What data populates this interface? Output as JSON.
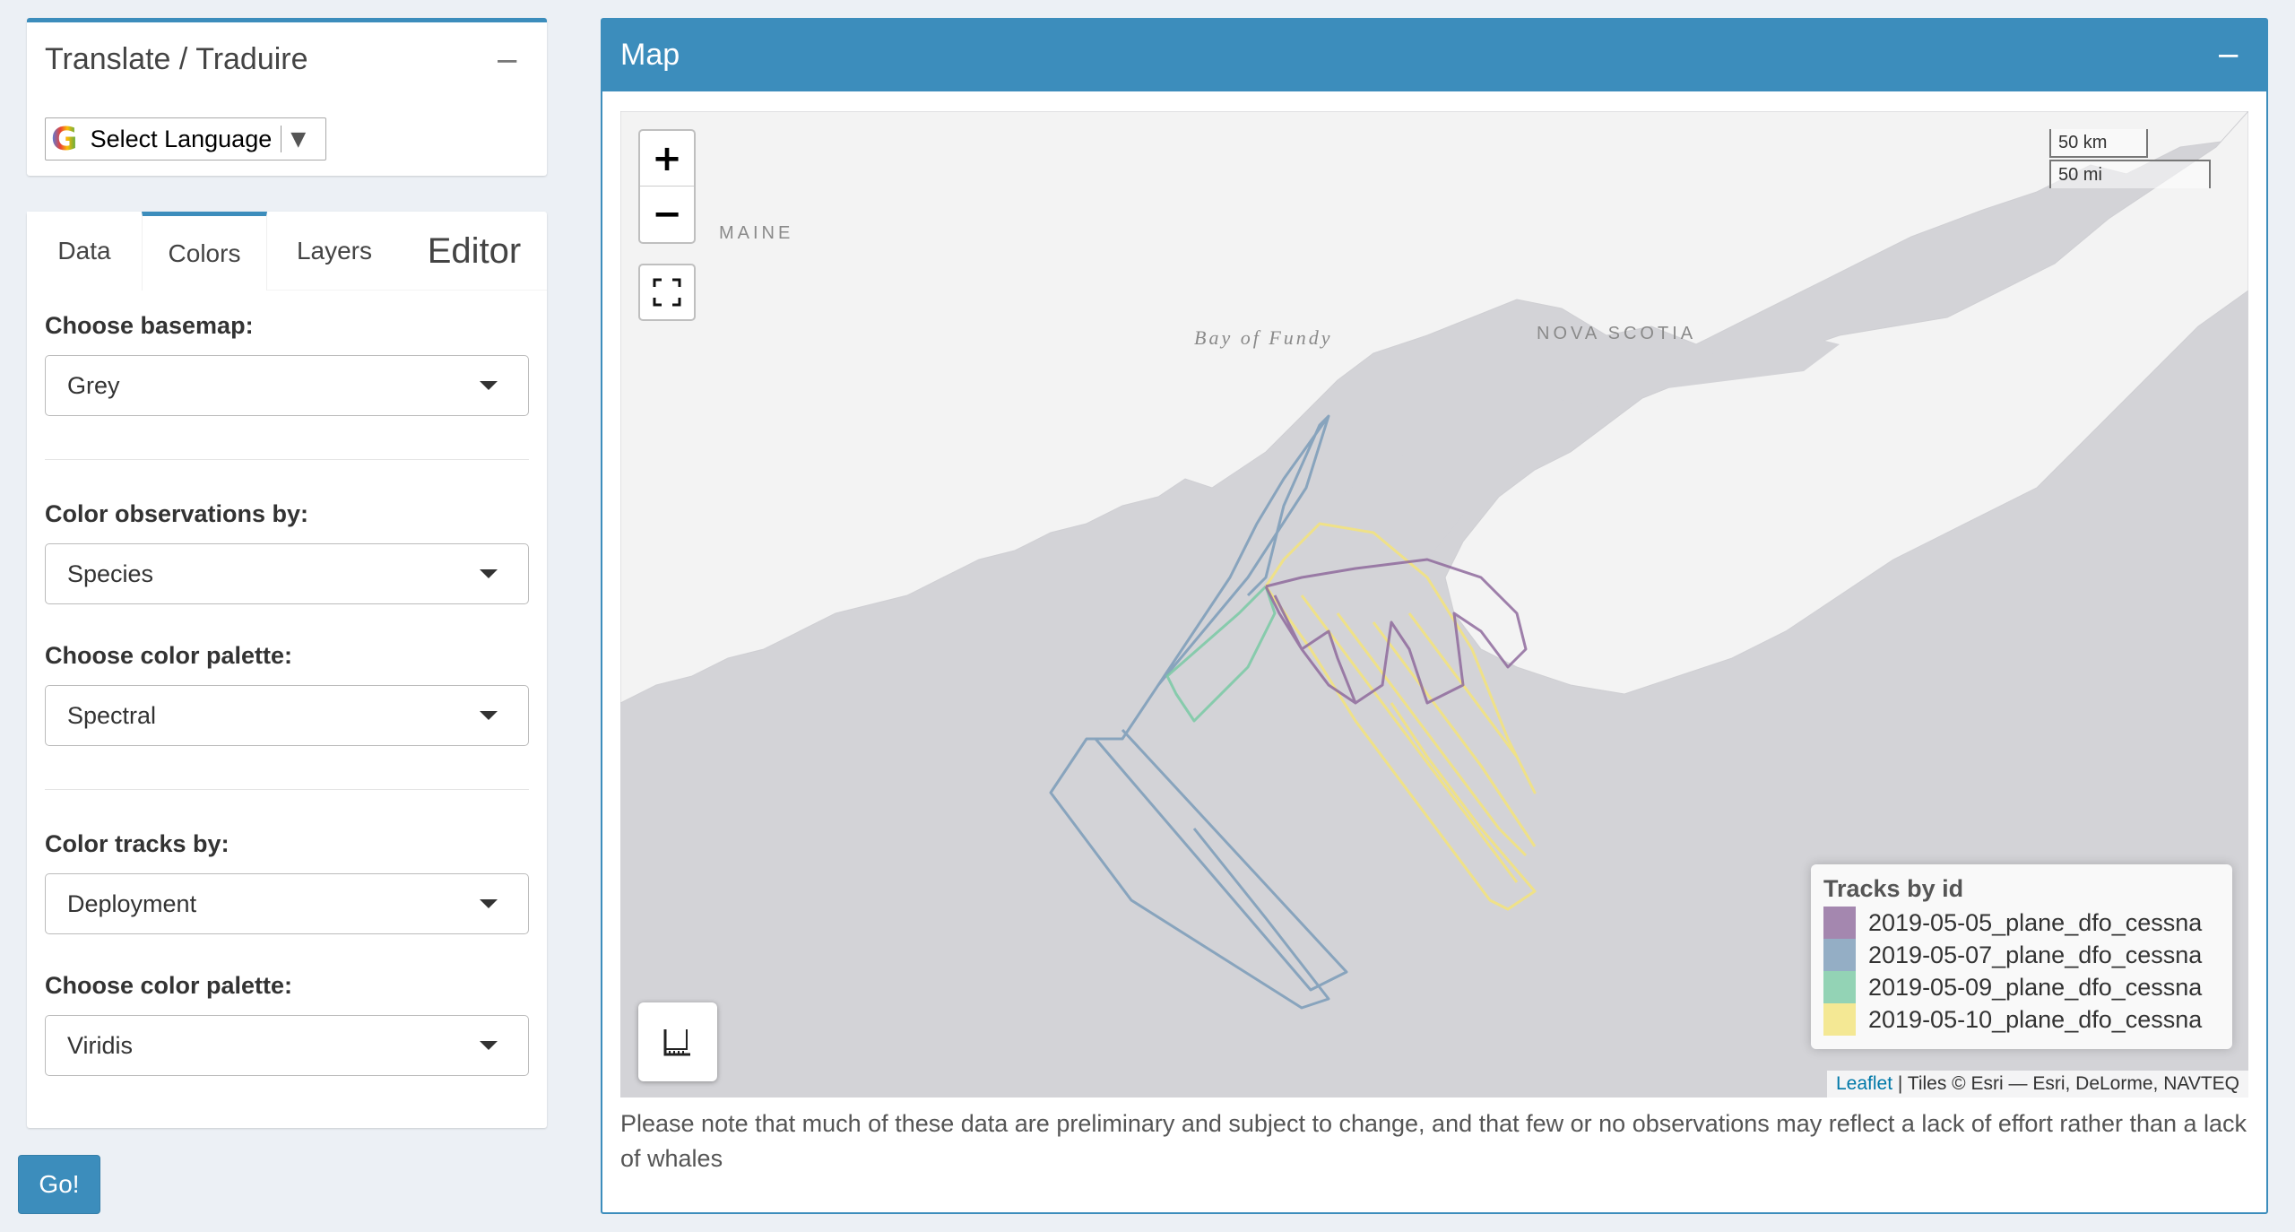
{
  "translate": {
    "title": "Translate / Traduire",
    "collapse_icon": "minus-icon",
    "select_label": "Select Language",
    "google_icon": "google-g-icon"
  },
  "tabs": [
    {
      "label": "Data",
      "active": false
    },
    {
      "label": "Colors",
      "active": true
    },
    {
      "label": "Layers",
      "active": false
    },
    {
      "label": "Editor",
      "active": false
    }
  ],
  "form": {
    "basemap_label": "Choose basemap:",
    "basemap_value": "Grey",
    "color_obs_label": "Color observations by:",
    "color_obs_value": "Species",
    "palette_obs_label": "Choose color palette:",
    "palette_obs_value": "Spectral",
    "color_tracks_label": "Color tracks by:",
    "color_tracks_value": "Deployment",
    "palette_tracks_label": "Choose color palette:",
    "palette_tracks_value": "Viridis",
    "go_label": "Go!"
  },
  "map": {
    "title": "Map",
    "collapse_icon": "minus-icon",
    "zoom_in": "+",
    "zoom_out": "−",
    "places": {
      "maine": "MAINE",
      "bay_of_fundy": "Bay of Fundy",
      "nova_scotia": "NOVA SCOTIA"
    },
    "scale_km": "50 km",
    "scale_mi": "50 mi",
    "legend": {
      "title": "Tracks by id",
      "items": [
        {
          "label": "2019-05-05_plane_dfo_cessna",
          "color": "#8e6a9c"
        },
        {
          "label": "2019-05-07_plane_dfo_cessna",
          "color": "#7a9bb8"
        },
        {
          "label": "2019-05-09_plane_dfo_cessna",
          "color": "#79c9a4"
        },
        {
          "label": "2019-05-10_plane_dfo_cessna",
          "color": "#f3e37a"
        }
      ]
    },
    "attribution": {
      "leaflet": "Leaflet",
      "rest": " | Tiles © Esri — Esri, DeLorme, NAVTEQ"
    },
    "colors": {
      "water": "#d3d3d7",
      "land": "#f3f3f3"
    }
  },
  "disclaimer": "Please note that much of these data are preliminary and subject to change, and that few or no observations may reflect a lack of effort rather than a lack of whales"
}
